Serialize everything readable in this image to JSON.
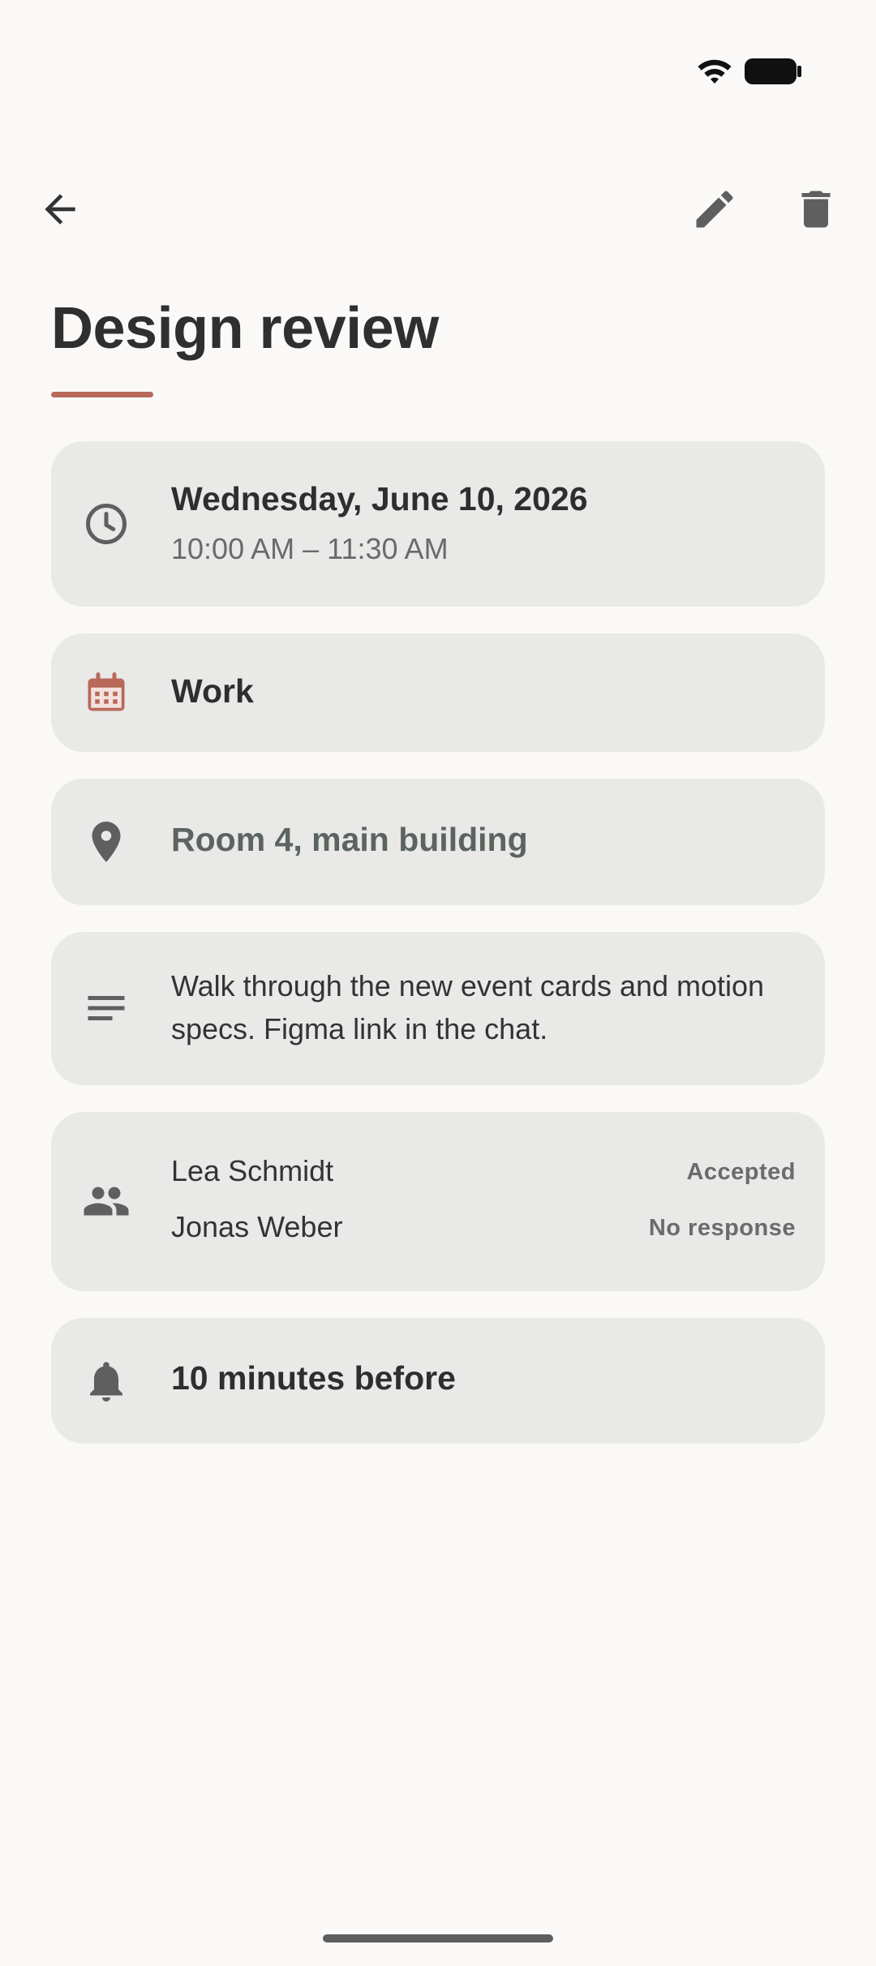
{
  "event": {
    "title": "Design review",
    "date": "Wednesday, June 10, 2026",
    "time_range": "10:00 AM – 11:30 AM",
    "calendar": "Work",
    "location": "Room 4, main building",
    "notes": "Walk through the new event cards and motion specs. Figma link in the chat.",
    "attendees": [
      {
        "name": "Lea Schmidt",
        "status": "Accepted"
      },
      {
        "name": "Jonas Weber",
        "status": "No response"
      }
    ],
    "reminder": "10 minutes before"
  },
  "icons": {
    "back": "arrow-back-icon",
    "edit": "pencil-icon",
    "delete": "trash-icon",
    "time": "clock-icon",
    "calendar": "calendar-icon",
    "location": "location-pin-icon",
    "notes": "notes-icon",
    "attendees": "people-icon",
    "reminder": "bell-icon"
  },
  "colors": {
    "accent": "#b8695a",
    "background": "#faf9f7",
    "card": "#e9e9e8"
  }
}
